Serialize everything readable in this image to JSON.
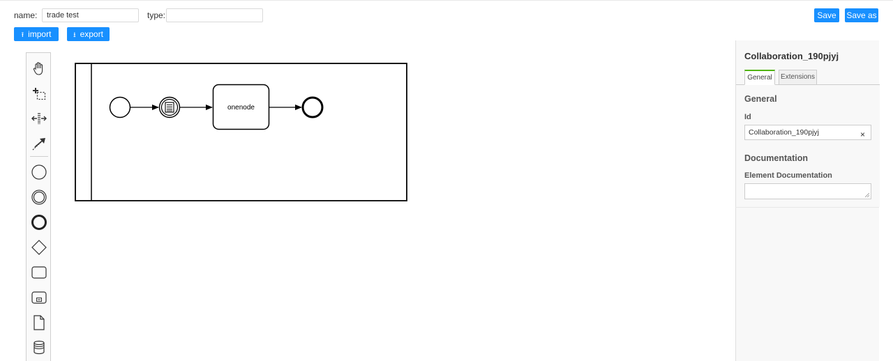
{
  "toolbar": {
    "name_label": "name:",
    "name_value": "trade test",
    "type_label": "type:",
    "type_value": "",
    "import_label": "import",
    "export_label": "export",
    "save_label": "Save",
    "save_as_label": "Save as",
    "button_color": "#1890ff"
  },
  "palette": {
    "tools": [
      "hand-tool-icon",
      "lasso-tool-icon",
      "space-tool-icon",
      "connect-tool-icon"
    ],
    "shapes": [
      "start-event-icon",
      "intermediate-event-icon",
      "end-event-icon",
      "gateway-icon",
      "task-icon",
      "subprocess-icon",
      "data-object-icon",
      "data-store-icon"
    ]
  },
  "diagram": {
    "task_label": "onenode"
  },
  "properties": {
    "title": "Collaboration_190pjyj",
    "tabs": [
      "General",
      "Extensions"
    ],
    "active_tab": "General",
    "section_general": "General",
    "id_label": "Id",
    "id_value": "Collaboration_190pjyj",
    "section_documentation": "Documentation",
    "doc_label": "Element Documentation",
    "doc_value": "",
    "accent_color": "#52b415"
  }
}
